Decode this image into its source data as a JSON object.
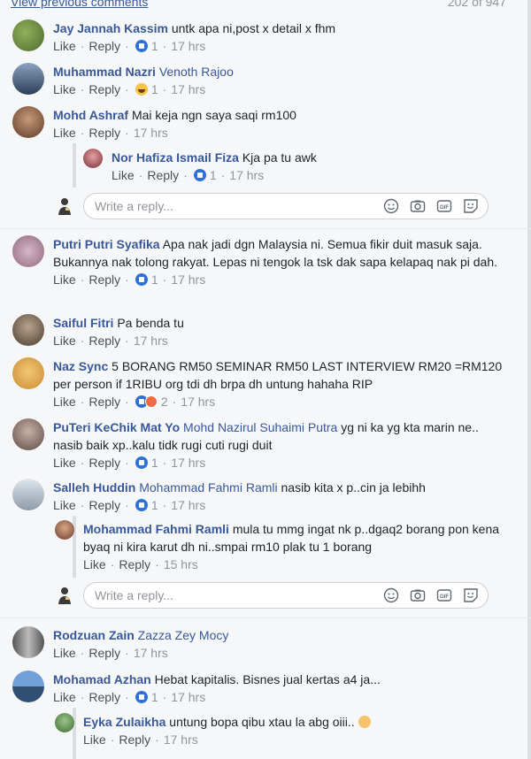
{
  "header": {
    "view_previous": "View previous comments",
    "count": "202 of 947"
  },
  "actions": {
    "like": "Like",
    "reply": "Reply",
    "sep": "·"
  },
  "write_reply": {
    "placeholder": "Write a reply..."
  },
  "comments": [
    {
      "author": "Jay Jannah Kassim",
      "tag": "",
      "text": "untk apa ni,post x detail x fhm",
      "reaction": "like",
      "reaction_count": "1",
      "time": "17 hrs"
    },
    {
      "author": "Muhammad Nazri",
      "tag": "Venoth Rajoo",
      "text": "",
      "reaction": "haha",
      "reaction_count": "1",
      "time": "17 hrs"
    },
    {
      "author": "Mohd Ashraf",
      "tag": "",
      "text": "Mai keja ngn saya saqi rm100",
      "reaction": "",
      "reaction_count": "",
      "time": "17 hrs"
    },
    {
      "author": "Nor Hafiza Ismail Fiza",
      "tag": "",
      "text": "Kja pa tu awk",
      "reaction": "like",
      "reaction_count": "1",
      "time": "17 hrs"
    },
    {
      "author": "Putri Putri Syafika",
      "tag": "",
      "text": "Apa nak jadi dgn Malaysia ni. Semua fikir duit masuk saja. Bukannya nak tolong rakyat. Lepas ni tengok la tsk dak sapa kelapaq nak pi dah.",
      "reaction": "like",
      "reaction_count": "1",
      "time": "17 hrs"
    },
    {
      "author": "Saiful Fitri",
      "tag": "",
      "text": "Pa benda tu",
      "reaction": "",
      "reaction_count": "",
      "time": "17 hrs"
    },
    {
      "author": "Naz Sync",
      "tag": "",
      "text": "5 BORANG RM50 SEMINAR RM50 LAST INTERVIEW RM20 =RM120 per person if 1RIBU org tdi dh brpa dh untung hahaha RIP",
      "reaction": "like-sad",
      "reaction_count": "2",
      "time": "17 hrs"
    },
    {
      "author": "PuTeri KeChik Mat Yo",
      "tag": "Mohd Nazirul Suhaimi Putra",
      "text": "yg ni ka yg kta marin ne.. nasib baik xp..kalu tidk rugi cuti rugi duit",
      "reaction": "like",
      "reaction_count": "1",
      "time": "17 hrs"
    },
    {
      "author": "Salleh Huddin",
      "tag": "Mohammad Fahmi Ramli",
      "text": "nasib kita x p..cin ja lebihh",
      "reaction": "like",
      "reaction_count": "1",
      "time": "17 hrs"
    },
    {
      "author": "Mohammad Fahmi Ramli",
      "tag": "",
      "text": "mula tu mmg ingat nk p..dgaq2 borang pon kena byaq ni kira karut dh ni..smpai rm10 plak tu 1 borang",
      "reaction": "",
      "reaction_count": "",
      "time": "15 hrs"
    },
    {
      "author": "Rodzuan Zain",
      "tag": "Zazza Zey Mocy",
      "text": "",
      "reaction": "",
      "reaction_count": "",
      "time": "17 hrs"
    },
    {
      "author": "Mohamad Azhan",
      "tag": "",
      "text": "Hebat kapitalis. Bisnes jual kertas a4 ja...",
      "reaction": "like",
      "reaction_count": "1",
      "time": "17 hrs"
    },
    {
      "author": "Eyka Zulaikha",
      "tag": "",
      "text": "untung bopa qibu xtau la abg oiii..",
      "reaction": "",
      "reaction_count": "",
      "time": "17 hrs"
    }
  ],
  "colors": {
    "link": "#385898",
    "meta": "#90949c",
    "like": "#2e6fd9"
  }
}
